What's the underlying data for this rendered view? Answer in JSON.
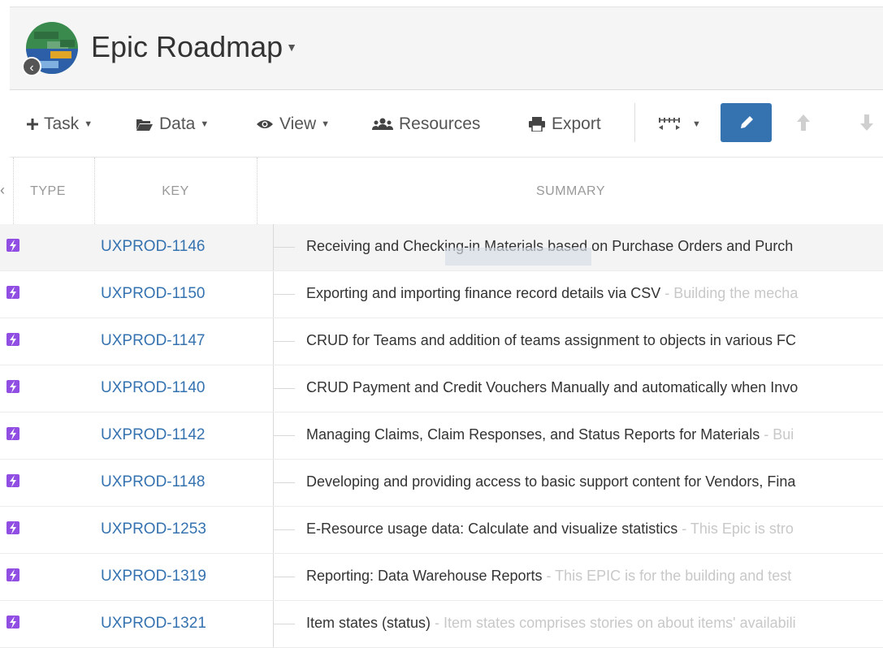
{
  "header": {
    "title": "Epic Roadmap",
    "back_icon": "chevron-left-icon"
  },
  "toolbar": {
    "task_label": "Task",
    "data_label": "Data",
    "view_label": "View",
    "resources_label": "Resources",
    "export_label": "Export"
  },
  "table": {
    "columns": {
      "type": "TYPE",
      "key": "KEY",
      "summary": "SUMMARY"
    },
    "rows": [
      {
        "key": "UXPROD-1146",
        "title": "Receiving and Checking-in Materials based on Purchase Orders and Purch",
        "desc": ""
      },
      {
        "key": "UXPROD-1150",
        "title": "Exporting and importing finance record details via CSV",
        "desc": " - Building the mecha"
      },
      {
        "key": "UXPROD-1147",
        "title": "CRUD for Teams and addition of teams assignment to objects in various FC",
        "desc": ""
      },
      {
        "key": "UXPROD-1140",
        "title": "CRUD Payment and Credit Vouchers Manually and automatically when Invo",
        "desc": ""
      },
      {
        "key": "UXPROD-1142",
        "title": "Managing Claims, Claim Responses, and Status Reports for Materials",
        "desc": " - Bui"
      },
      {
        "key": "UXPROD-1148",
        "title": "Developing and providing access to basic support content for Vendors, Fina",
        "desc": ""
      },
      {
        "key": "UXPROD-1253",
        "title": "E-Resource usage data: Calculate and visualize statistics",
        "desc": " - This Epic is stro"
      },
      {
        "key": "UXPROD-1319",
        "title": "Reporting: Data Warehouse Reports",
        "desc": " - This EPIC is for the building and test"
      },
      {
        "key": "UXPROD-1321",
        "title": "Item states (status)",
        "desc": " - Item states comprises stories on about items' availabili"
      }
    ]
  },
  "colors": {
    "accent": "#3572b0",
    "epic_icon": "#904ee2",
    "muted_text": "#999999"
  }
}
